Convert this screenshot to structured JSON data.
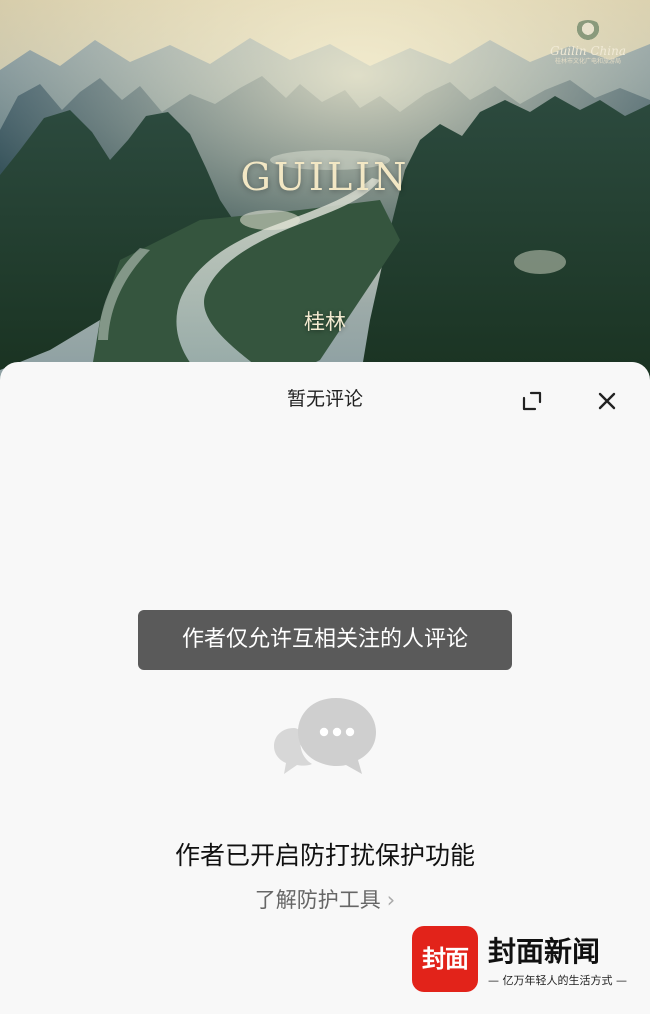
{
  "hero": {
    "title": "GUILIN",
    "subtitle": "桂林",
    "logo_text": "Guilin China",
    "logo_subtext": "桂林市文化广电和旅游局"
  },
  "sheet": {
    "title": "暂无评论",
    "expand_icon": "expand-icon",
    "close_icon": "close-icon",
    "toast": "作者仅允许互相关注的人评论",
    "empty_icon": "comment-bubbles-icon",
    "message": "作者已开启防打扰保护功能",
    "link_label": "了解防护工具",
    "link_chevron": "›"
  },
  "watermark": {
    "badge": "封面",
    "name": "封面新闻",
    "slogan": "— 亿万年轻人的生活方式 —",
    "badge_color": "#e2231a"
  },
  "colors": {
    "sheet_background": "#f8f8f8",
    "toast_background": "#5a5a5a",
    "hero_title": "#f2e7c4"
  }
}
